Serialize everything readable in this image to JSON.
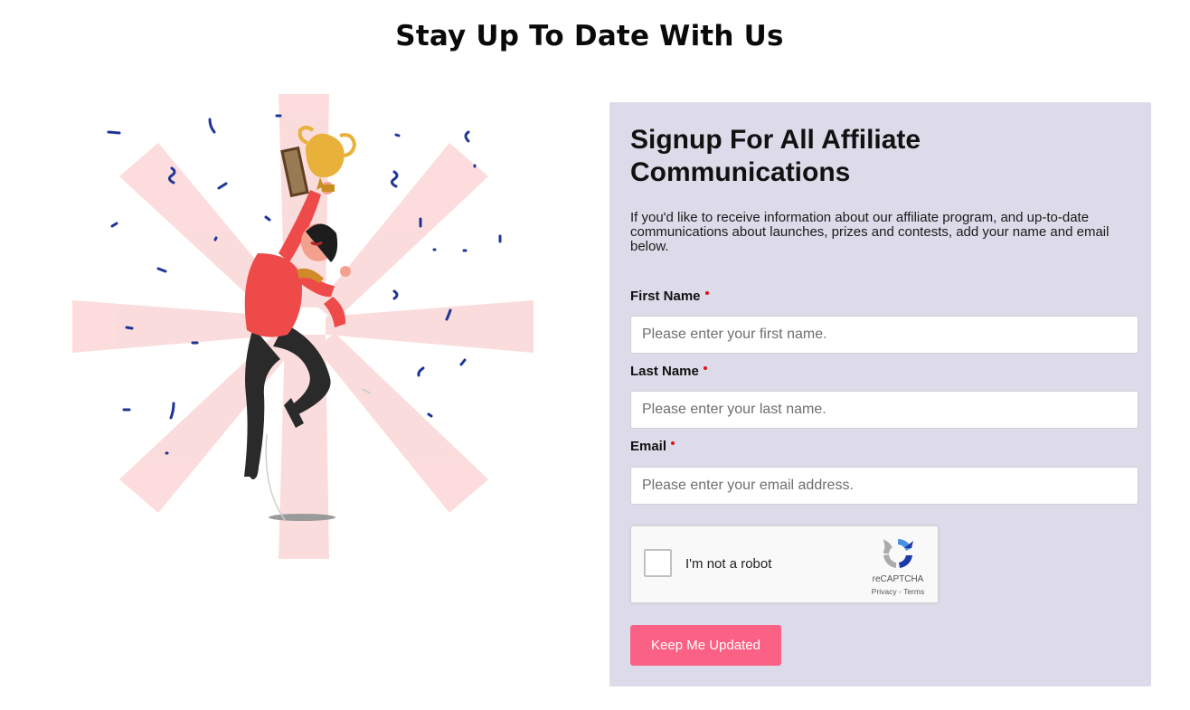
{
  "page": {
    "title": "Stay Up To Date With Us"
  },
  "form": {
    "title": "Signup For All Affiliate Communications",
    "description": "If you'd like to receive information about our affiliate program, and up-to-date communications about launches, prizes and contests, add your name and email below.",
    "fields": [
      {
        "label": "First Name",
        "placeholder": "Please enter your first name.",
        "value": "",
        "required": true
      },
      {
        "label": "Last Name",
        "placeholder": "Please enter your last name.",
        "value": "",
        "required": true
      },
      {
        "label": "Email",
        "placeholder": "Please enter your email address.",
        "value": "",
        "required": true
      }
    ],
    "captcha": {
      "label": "I'm not a robot",
      "brand": "reCAPTCHA",
      "privacy": "Privacy",
      "separator": " - ",
      "terms": "Terms",
      "checked": false
    },
    "submit_label": "Keep Me Updated"
  },
  "illustration": {
    "icon": "celebrating-man-with-trophy-illustration"
  },
  "colors": {
    "panel_bg": "#dddbe9",
    "button": "#fb6184",
    "required_dot": "#e0101a",
    "confetti": "#1f3596",
    "rays": "#fbd3d3",
    "shirt": "#ee4a4a",
    "trophy": "#e8b13a"
  }
}
